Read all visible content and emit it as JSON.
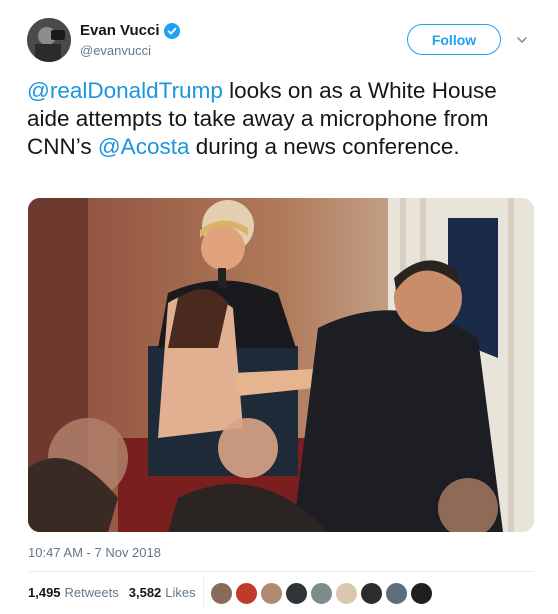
{
  "author": {
    "name": "Evan Vucci",
    "handle": "@evanvucci",
    "verified": true,
    "avatar_icon": "avatar-photo"
  },
  "follow_button": {
    "label": "Follow"
  },
  "menu_icon": "chevron-down-icon",
  "tweet": {
    "segments": [
      {
        "text": "@realDonaldTrump",
        "type": "mention"
      },
      {
        "text": " looks on as a White House aide attempts to take away a microphone from CNN’s ",
        "type": "text"
      },
      {
        "text": "@Acosta",
        "type": "mention"
      },
      {
        "text": " during a news conference.",
        "type": "text"
      }
    ]
  },
  "timestamp": "10:47 AM - 7 Nov 2018",
  "stats": {
    "retweets_count": "1,495",
    "retweets_label": "Retweets",
    "likes_count": "3,582",
    "likes_label": "Likes"
  },
  "likers": [
    "#8a6a5a",
    "#c0392b",
    "#b08a70",
    "#2f3437",
    "#7f8c8d",
    "#d9c7b0",
    "#2c2c2c",
    "#5d6d7e",
    "#1f1f1f"
  ],
  "colors": {
    "accent": "#1da1f2",
    "mention": "#1b95e0",
    "secondary_text": "#657786"
  }
}
